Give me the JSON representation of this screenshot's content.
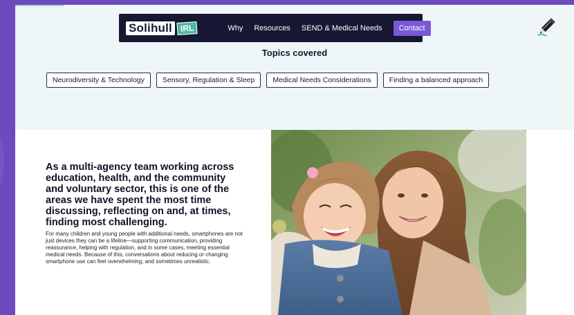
{
  "nav": {
    "logo_text": "Solihull",
    "logo_badge": "IRL",
    "links": [
      "Why",
      "Resources",
      "SEND & Medical Needs"
    ],
    "contact_label": "Contact"
  },
  "topics": {
    "title": "Topics covered",
    "chips": [
      "Neurodiversity & Technology",
      "Sensory, Regulation & Sleep",
      "Medical Needs Considerations",
      "Finding a balanced approach"
    ]
  },
  "main": {
    "headline": "As a multi-agency team working across education, health, and the community and voluntary sector, this is one of the areas we have spent the most time discussing, reflecting on and, at times, finding most challenging.",
    "body": "For many children and young people with additional needs, smartphones are not just devices they can be a lifeline—supporting communication, providing reassurance, helping with regulation, and in some cases, meeting essential medical needs. Because of this, conversations about reducing or changing smartphone use can feel overwhelming, and sometimes unrealistic."
  },
  "colors": {
    "outer_bg": "#6b4bbd",
    "page_bg": "#eef6f8",
    "nav_bg": "#151733",
    "accent": "#7a58d6",
    "logo_badge": "#4fb7a3"
  },
  "icons": [
    "pencil-icon"
  ]
}
